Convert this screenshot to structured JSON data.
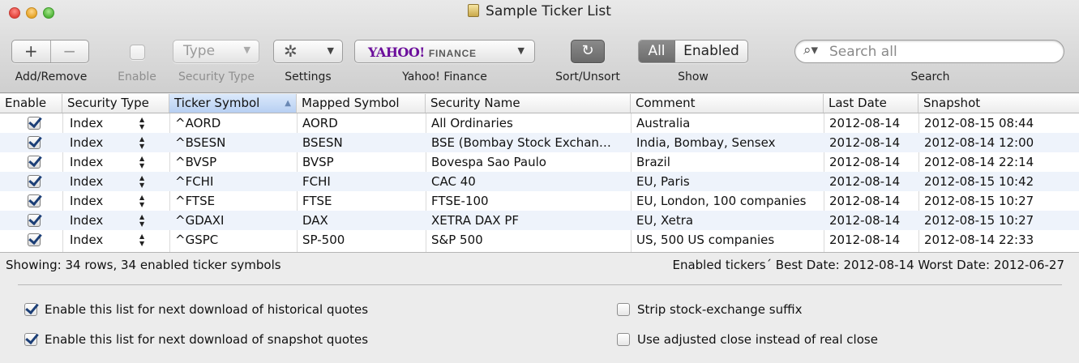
{
  "window": {
    "title": "Sample Ticker List"
  },
  "toolbar": {
    "add_glyph": "+",
    "remove_glyph": "−",
    "add_remove_label": "Add/Remove",
    "enable_label": "Enable",
    "type_value": "Type",
    "security_type_label": "Security Type",
    "settings_label": "Settings",
    "yahoo_logo": "YAHOO!",
    "yahoo_logo_suffix": "FINANCE",
    "yahoo_label": "Yahoo! Finance",
    "sort_label": "Sort/Unsort",
    "show_all": "All",
    "show_enabled": "Enabled",
    "show_label": "Show",
    "search_placeholder": "Search all",
    "search_label": "Search"
  },
  "table": {
    "columns": [
      "Enable",
      "Security Type",
      "Ticker Symbol",
      "Mapped Symbol",
      "Security Name",
      "Comment",
      "Last Date",
      "Snapshot"
    ],
    "sorted_column": "Ticker Symbol",
    "rows": [
      {
        "enabled": true,
        "type": "Index",
        "ticker": "^AORD",
        "mapped": "AORD",
        "name": "All Ordinaries",
        "comment": "Australia",
        "last_date": "2012-08-14",
        "snapshot": "2012-08-15 08:44"
      },
      {
        "enabled": true,
        "type": "Index",
        "ticker": "^BSESN",
        "mapped": "BSESN",
        "name": "BSE (Bombay Stock Exchan…",
        "comment": "India, Bombay, Sensex",
        "last_date": "2012-08-14",
        "snapshot": "2012-08-14 12:00"
      },
      {
        "enabled": true,
        "type": "Index",
        "ticker": "^BVSP",
        "mapped": "BVSP",
        "name": "Bovespa Sao Paulo",
        "comment": "Brazil",
        "last_date": "2012-08-14",
        "snapshot": "2012-08-14 22:14"
      },
      {
        "enabled": true,
        "type": "Index",
        "ticker": "^FCHI",
        "mapped": "FCHI",
        "name": "CAC 40",
        "comment": "EU, Paris",
        "last_date": "2012-08-14",
        "snapshot": "2012-08-15 10:42"
      },
      {
        "enabled": true,
        "type": "Index",
        "ticker": "^FTSE",
        "mapped": "FTSE",
        "name": "FTSE-100",
        "comment": "EU, London, 100 companies",
        "last_date": "2012-08-14",
        "snapshot": "2012-08-15 10:27"
      },
      {
        "enabled": true,
        "type": "Index",
        "ticker": "^GDAXI",
        "mapped": "DAX",
        "name": "XETRA DAX PF",
        "comment": "EU, Xetra",
        "last_date": "2012-08-14",
        "snapshot": "2012-08-15 10:27"
      },
      {
        "enabled": true,
        "type": "Index",
        "ticker": "^GSPC",
        "mapped": "SP-500",
        "name": "S&P 500",
        "comment": "US, 500 US companies",
        "last_date": "2012-08-14",
        "snapshot": "2012-08-14 22:33"
      }
    ]
  },
  "status": {
    "left": "Showing: 34 rows, 34 enabled ticker symbols",
    "right": "Enabled tickers´ Best Date: 2012-08-14  Worst Date: 2012-06-27"
  },
  "options": [
    {
      "label": "Enable this list for next download of historical quotes",
      "checked": true
    },
    {
      "label": "Enable this list for next download of snapshot quotes",
      "checked": true
    },
    {
      "label": "Strip stock-exchange suffix",
      "checked": false
    },
    {
      "label": "Use adjusted close instead of real close",
      "checked": false
    }
  ],
  "colors": {
    "selection_header": "#b7cff2",
    "alt_row": "#eef3fb",
    "check": "#1c3f77"
  }
}
